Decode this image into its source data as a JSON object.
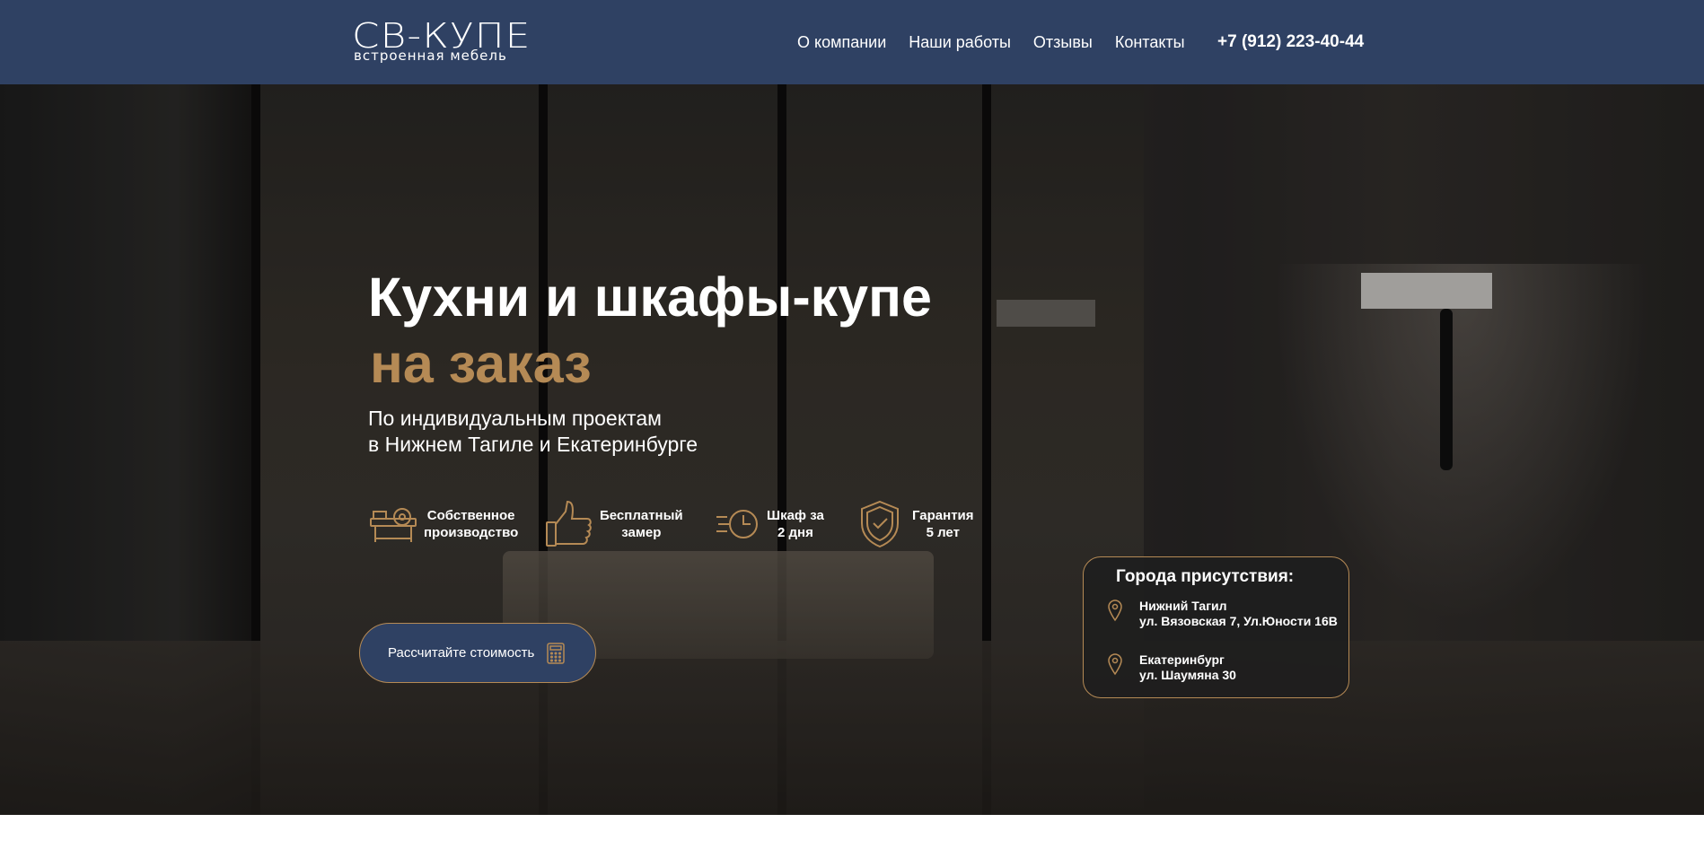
{
  "brand": {
    "logo_main": "СВ-КУПЕ",
    "logo_sub": "встроенная мебель"
  },
  "nav": {
    "items": [
      {
        "label": "О компании"
      },
      {
        "label": "Наши работы"
      },
      {
        "label": "Отзывы"
      },
      {
        "label": "Контакты"
      }
    ],
    "phone": "+7 (912) 223-40-44"
  },
  "hero": {
    "title_line1": "Кухни и шкафы-купе",
    "title_line2": "на заказ",
    "subtitle_line1": "По индивидуальным проектам",
    "subtitle_line2": "в Нижнем Тагиле и Екатеринбурге",
    "features": [
      {
        "label": "Собственное\nпроизводство",
        "icon": "saw-machine-icon"
      },
      {
        "label": "Бесплатный\nзамер",
        "icon": "thumbs-up-icon"
      },
      {
        "label": "Шкаф за\n2 дня",
        "icon": "fast-clock-icon"
      },
      {
        "label": "Гарантия\n5 лет",
        "icon": "shield-check-icon"
      }
    ],
    "cta_label": "Рассчитайте стоимость",
    "cta_icon": "calculator-icon"
  },
  "cities": {
    "title": "Города присутствия:",
    "items": [
      {
        "name": "Нижний Тагил",
        "address": "ул. Вязовская 7,  Ул.Юности 16В"
      },
      {
        "name": "Екатеринбург",
        "address": "ул. Шаумяна 30"
      }
    ]
  },
  "colors": {
    "header_bg": "#2f4163",
    "accent_gold": "#b58a55",
    "text_white": "#ffffff"
  }
}
